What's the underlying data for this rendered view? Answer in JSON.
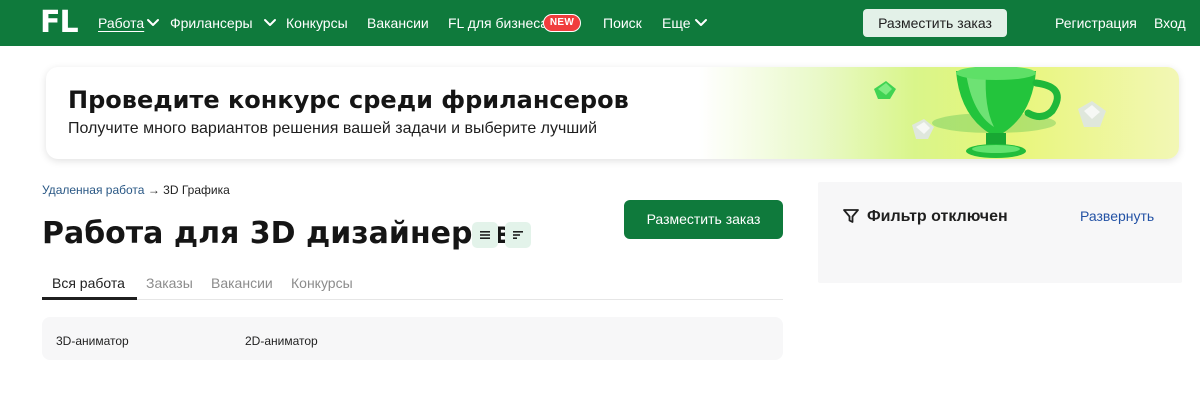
{
  "header": {
    "logo": "FL",
    "nav": [
      {
        "label": "Работа",
        "active": true
      },
      {
        "label": "Фрилансеры"
      },
      {
        "label": "Конкурсы"
      },
      {
        "label": "Вакансии"
      },
      {
        "label": "FL для бизнеса",
        "badge": "NEW"
      },
      {
        "label": "Поиск"
      },
      {
        "label": "Еще"
      }
    ],
    "cta_label": "Разместить заказ",
    "register_label": "Регистрация",
    "login_label": "Вход"
  },
  "banner": {
    "title": "Проведите конкурс среди фрилансеров",
    "subtitle": "Получите много вариантов решения вашей задачи и выберите лучший"
  },
  "breadcrumb": {
    "link_label": "Удаленная работа",
    "separator": "→",
    "current": "3D Графика"
  },
  "page": {
    "title": "Работа для 3D дизайнеров",
    "cta_label": "Разместить заказ"
  },
  "tabs": [
    {
      "label": "Вся работа",
      "active": true
    },
    {
      "label": "Заказы"
    },
    {
      "label": "Вакансии"
    },
    {
      "label": "Конкурсы"
    }
  ],
  "subcategories": [
    "3D-аниматор",
    "2D-аниматор"
  ],
  "filter": {
    "status_label": "Фильтр отключен",
    "expand_label": "Развернуть"
  },
  "colors": {
    "brand_green": "#0f7a3c",
    "link_blue": "#2352a5",
    "badge_red": "#f03d3d"
  }
}
